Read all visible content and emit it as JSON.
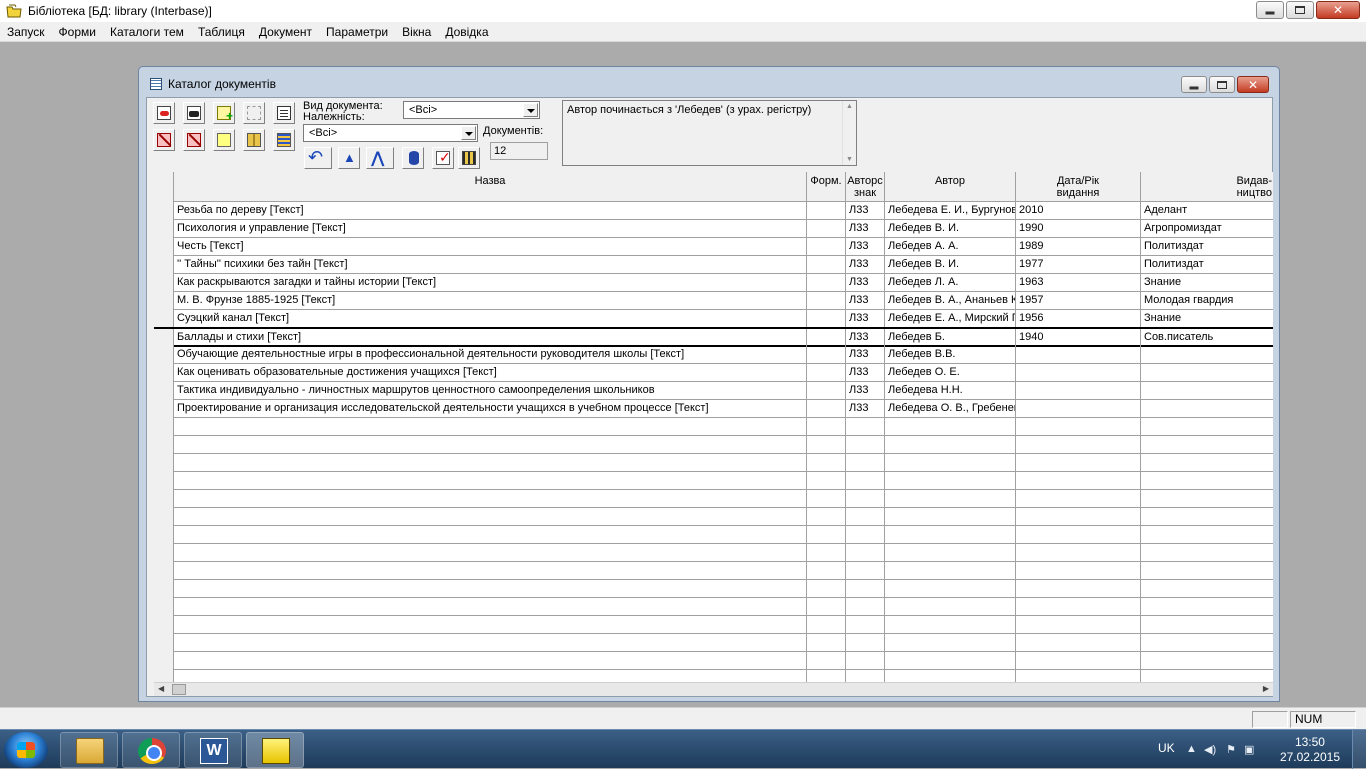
{
  "app": {
    "title": "Бібліотека [БД: library (Interbase)]"
  },
  "menu": [
    "Запуск",
    "Форми",
    "Каталоги тем",
    "Таблиця",
    "Документ",
    "Параметри",
    "Вікна",
    "Довідка"
  ],
  "window": {
    "title": "Каталог документів"
  },
  "toolbar": {
    "doc_type_label": "Вид документа:",
    "belonging_label": "Належність:",
    "doc_type_value": "<Всі>",
    "belonging_value": "<Всі>",
    "count_label": "Документів:",
    "count_value": "12",
    "filter_text": "Автор починається з 'Лебедев' (з урах. регістру)"
  },
  "grid": {
    "headers": [
      "Назва",
      "Форм.",
      "Авторс\nзнак",
      "Автор",
      "Дата/Рік\nвидання",
      "Видав-\nництво"
    ],
    "rows": [
      [
        "Резьба по дереву [Текст]",
        "",
        "Л33",
        "Лебедева Е. И., Бургунов",
        "2010",
        "Аделант"
      ],
      [
        "Психология и управление [Текст]",
        "",
        "Л33",
        "Лебедев В. И.",
        "1990",
        "Агропромиздат"
      ],
      [
        "Честь [Текст]",
        "",
        "Л33",
        "Лебедев А. А.",
        "1989",
        "Политиздат"
      ],
      [
        "'' Тайны'' психики без тайн [Текст]",
        "",
        "Л33",
        "Лебедев В. И.",
        "1977",
        "Политиздат"
      ],
      [
        "Как раскрываются загадки и тайны истории [Текст]",
        "",
        "Л33",
        "Лебедев Л. А.",
        "1963",
        "Знание"
      ],
      [
        "М. В. Фрунзе 1885-1925 [Текст]",
        "",
        "Л33",
        "Лебедев В. А., Ананьев К",
        "1957",
        "Молодая гвардия"
      ],
      [
        "Суэцкий канал [Текст]",
        "",
        "Л33",
        "Лебедев Е. А., Мирский Г",
        "1956",
        "Знание"
      ],
      [
        "Баллады и стихи [Текст]",
        "",
        "Л33",
        "Лебедев Б.",
        "1940",
        "Сов.писатель"
      ],
      [
        "Обучающие деятельностные игры в профессиональной деятельности руководителя школы [Текст]",
        "",
        "Л33",
        "Лебедев В.В.",
        "",
        ""
      ],
      [
        "Как оценивать образовательные достижения учащихся [Текст]",
        "",
        "Л33",
        "Лебедев О. Е.",
        "",
        ""
      ],
      [
        "Тактика индивидуально - личностных маршрутов ценностного самоопределения школьников",
        "",
        "Л33",
        "Лебедева Н.Н.",
        "",
        ""
      ],
      [
        "Проектирование и организация исследовательской деятельности учащихся в учебном процессе [Текст]",
        "",
        "Л33",
        "Лебедева О. В., Гребенев",
        "",
        ""
      ]
    ],
    "selected_index": 7
  },
  "statusbar": {
    "num": "NUM"
  },
  "taskbar": {
    "lang": "UK",
    "time": "13:50",
    "date": "27.02.2015"
  }
}
